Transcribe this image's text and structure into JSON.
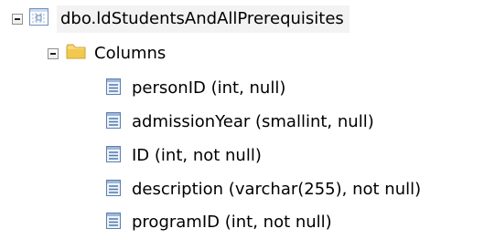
{
  "tree": {
    "table": {
      "label": "dbo.ldStudentsAndAllPrerequisites",
      "expander_icon": "minus-box-icon",
      "icon": "table-icon"
    },
    "columns_folder": {
      "label": "Columns",
      "expander_icon": "minus-box-icon",
      "icon": "folder-icon"
    },
    "columns": [
      {
        "label": "personID (int, null)",
        "icon": "column-icon"
      },
      {
        "label": "admissionYear (smallint, null)",
        "icon": "column-icon"
      },
      {
        "label": "ID (int, not null)",
        "icon": "column-icon"
      },
      {
        "label": "description (varchar(255), not null)",
        "icon": "column-icon"
      },
      {
        "label": "programID (int, not null)",
        "icon": "column-icon"
      }
    ]
  },
  "colors": {
    "folder": "#f2c94c",
    "table_icon": "#5a7fb0",
    "column_icon": "#4f79a8"
  }
}
